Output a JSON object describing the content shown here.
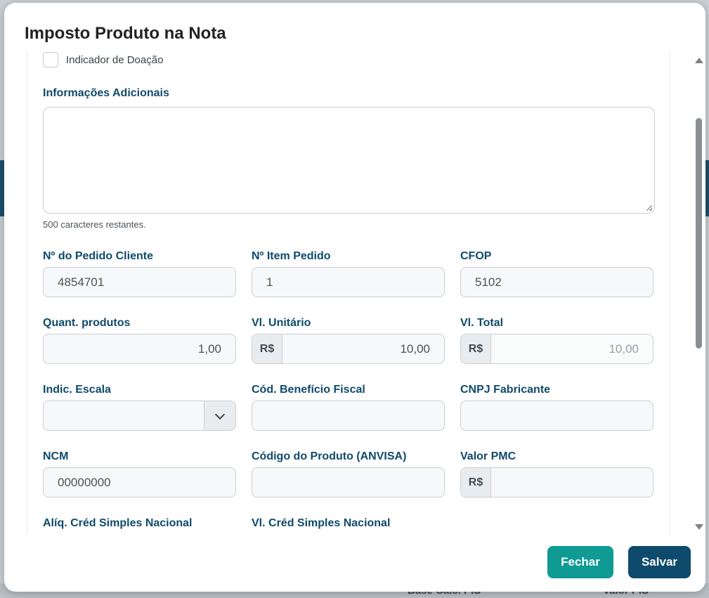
{
  "dialog": {
    "title": "Imposto Produto na Nota"
  },
  "form": {
    "donation_indicator": {
      "label": "Indicador de Doação",
      "checked": false
    },
    "additional_info": {
      "label": "Informações Adicionais",
      "value": "",
      "helper": "500 caracteres restantes."
    },
    "client_order_no": {
      "label": "Nº do Pedido Cliente",
      "value": "4854701"
    },
    "order_item_no": {
      "label": "Nº Item Pedido",
      "value": "1"
    },
    "cfop": {
      "label": "CFOP",
      "value": "5102"
    },
    "quantity": {
      "label": "Quant. produtos",
      "value": "1,00"
    },
    "unit_value": {
      "label": "Vl. Unitário",
      "prefix": "R$",
      "value": "10,00"
    },
    "total_value": {
      "label": "Vl. Total",
      "prefix": "R$",
      "value": "10,00"
    },
    "scale_indicator": {
      "label": "Indic. Escala",
      "value": ""
    },
    "tax_benefit_code": {
      "label": "Cód. Benefício Fiscal",
      "value": ""
    },
    "manufacturer_cnpj": {
      "label": "CNPJ Fabricante",
      "value": ""
    },
    "ncm": {
      "label": "NCM",
      "value": "00000000"
    },
    "anvisa_code": {
      "label": "Código do Produto (ANVISA)",
      "value": ""
    },
    "pmc_value": {
      "label": "Valor PMC",
      "prefix": "R$",
      "value": ""
    },
    "simples_rate": {
      "label": "Alíq. Créd Simples Nacional"
    },
    "simples_value": {
      "label": "Vl. Créd Simples Nacional"
    }
  },
  "buttons": {
    "close": "Fechar",
    "save": "Salvar"
  },
  "background": {
    "col1": "Base Calc. PIS",
    "col2": "Valor PIS"
  }
}
